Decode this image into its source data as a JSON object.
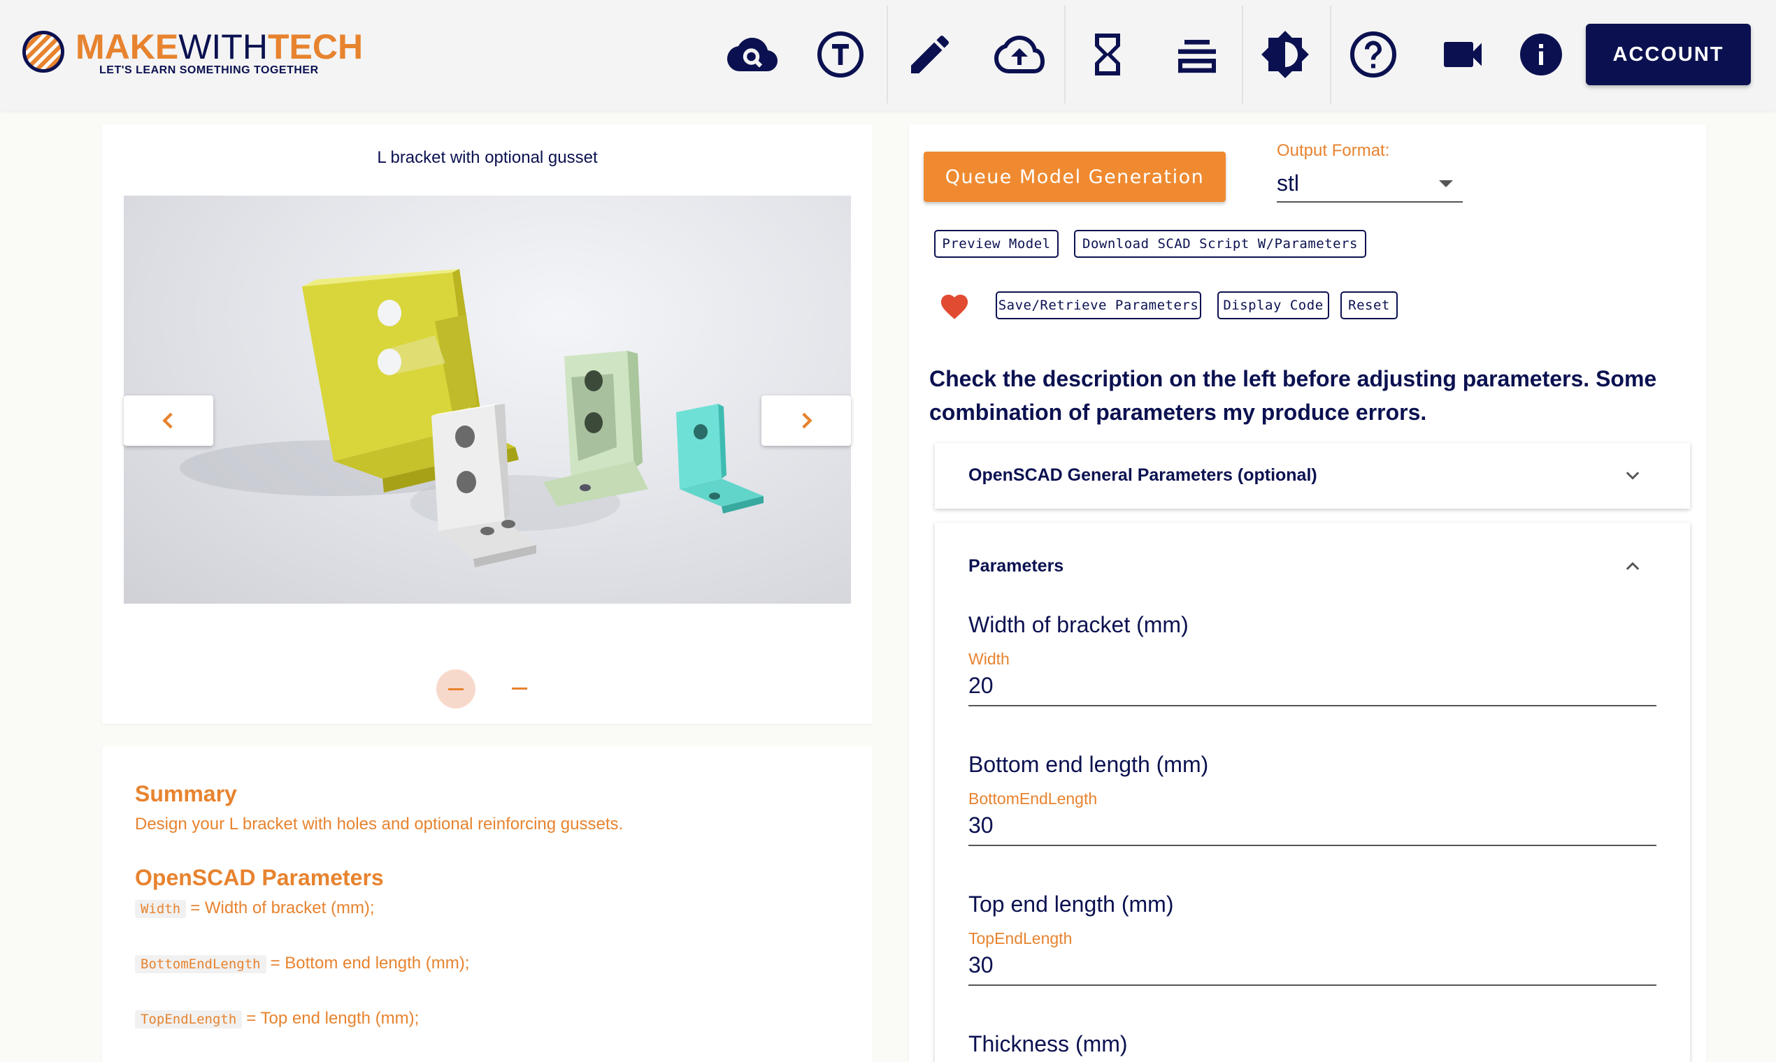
{
  "brand": {
    "name_part1": "MAKE",
    "name_part2": "WITH",
    "name_part3": "TECH",
    "tagline": "LET'S LEARN SOMETHING TOGETHER",
    "accent_color": "#e7832f",
    "primary_color": "#0b1150"
  },
  "toolbar": {
    "icons": [
      "cloud-search-icon",
      "text-t-icon",
      "pencil-icon",
      "cloud-upload-icon",
      "hourglass-icon",
      "queue-list-icon",
      "brightness-icon",
      "help-icon",
      "video-camera-icon",
      "info-icon"
    ],
    "account_label": "ACCOUNT"
  },
  "gallery": {
    "title": "L bracket with optional gusset",
    "slide_count": 2,
    "active_slide": 1
  },
  "summary": {
    "summary_heading": "Summary",
    "summary_text": "Design your L bracket with holes and optional reinforcing gussets.",
    "params_heading": "OpenSCAD Parameters",
    "params": [
      {
        "code": "Width",
        "text": "= Width of bracket (mm);"
      },
      {
        "code": "BottomEndLength",
        "text": "= Bottom end length (mm);"
      },
      {
        "code": "TopEndLength",
        "text": "= Top end length (mm);"
      }
    ]
  },
  "controls": {
    "queue_label": "Queue Model Generation",
    "output_format_label": "Output Format:",
    "output_format_value": "stl",
    "preview_label": "Preview Model",
    "download_label": "Download SCAD Script W/Parameters",
    "save_label": "Save/Retrieve Parameters",
    "display_code_label": "Display Code",
    "reset_label": "Reset",
    "warning_text": "Check the description on the left before adjusting parameters. Some combination of parameters my produce errors."
  },
  "general_panel": {
    "title": "OpenSCAD General Parameters (optional)",
    "expanded": false
  },
  "parameters_panel": {
    "title": "Parameters",
    "expanded": true,
    "fields": [
      {
        "label": "Width of bracket (mm)",
        "variable": "Width",
        "value": "20"
      },
      {
        "label": "Bottom end length (mm)",
        "variable": "BottomEndLength",
        "value": "30"
      },
      {
        "label": "Top end length (mm)",
        "variable": "TopEndLength",
        "value": "30"
      },
      {
        "label": "Thickness (mm)"
      }
    ]
  }
}
